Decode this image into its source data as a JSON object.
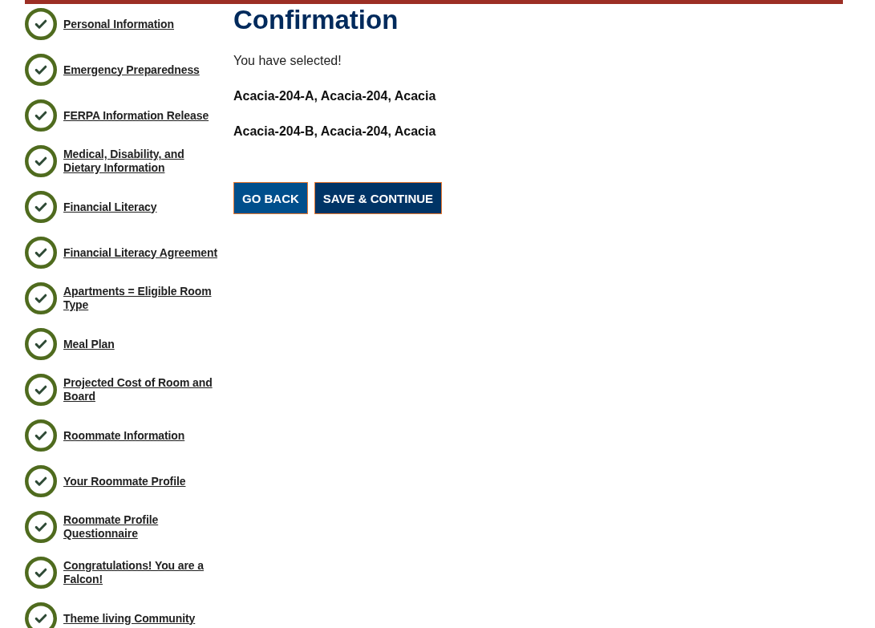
{
  "steps": [
    {
      "label": "Personal Information",
      "completed": true
    },
    {
      "label": "Emergency Preparedness",
      "completed": true
    },
    {
      "label": "FERPA Information Release",
      "completed": true
    },
    {
      "label": "Medical, Disability, and Dietary Information",
      "completed": true
    },
    {
      "label": "Financial Literacy",
      "completed": true
    },
    {
      "label": "Financial Literacy Agreement",
      "completed": true
    },
    {
      "label": "Apartments = Eligible Room Type",
      "completed": true
    },
    {
      "label": "Meal Plan",
      "completed": true
    },
    {
      "label": "Projected Cost of Room and Board",
      "completed": true
    },
    {
      "label": "Roommate Information",
      "completed": true
    },
    {
      "label": "Your Roommate Profile",
      "completed": true
    },
    {
      "label": "Roommate Profile Questionnaire",
      "completed": true
    },
    {
      "label": "Congratulations! You are a Falcon!",
      "completed": true
    },
    {
      "label": "Theme living Community",
      "completed": true
    }
  ],
  "content": {
    "heading": "Confirmation",
    "intro": "You have selected!",
    "selections": [
      "Acacia-204-A, Acacia-204, Acacia",
      "Acacia-204-B, Acacia-204, Acacia"
    ]
  },
  "buttons": [
    {
      "label": "GO BACK",
      "kind": "secondary"
    },
    {
      "label": "SAVE & CONTINUE",
      "kind": "primary"
    }
  ]
}
